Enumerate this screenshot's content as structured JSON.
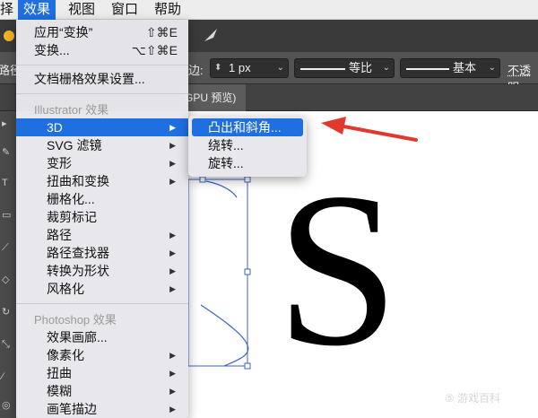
{
  "menubar": {
    "items": [
      {
        "label": "择"
      },
      {
        "label": "效果",
        "active": true
      },
      {
        "label": "视图"
      },
      {
        "label": "窗口"
      },
      {
        "label": "帮助"
      }
    ]
  },
  "controlbar": {
    "path_label": "路径",
    "edge_label": "边:",
    "stroke_weight": "1 px",
    "profile_label": "等比",
    "brush_label": "基本",
    "opacity_label": "不透明"
  },
  "tabbar": {
    "doc_tab": "GPU 预览)"
  },
  "effect_menu": {
    "apply_last": {
      "label": "应用“变换”",
      "shortcut": "⇧⌘E"
    },
    "last_effect": {
      "label": "变换...",
      "shortcut": "⌥⇧⌘E"
    },
    "raster_settings": "文档栅格效果设置...",
    "illustrator_header": "Illustrator 效果",
    "illustrator_items": [
      "3D",
      "SVG 滤镜",
      "变形",
      "扭曲和变换",
      "栅格化...",
      "裁剪标记",
      "路径",
      "路径查找器",
      "转换为形状",
      "风格化"
    ],
    "photoshop_header": "Photoshop 效果",
    "photoshop_items": [
      "效果画廊...",
      "像素化",
      "扭曲",
      "模糊",
      "画笔描边"
    ]
  },
  "submenu_3d": {
    "items": [
      "凸出和斜角...",
      "绕转...",
      "旋转..."
    ]
  },
  "canvas": {
    "letter": "S",
    "watermark": "⑤ 游戏百科"
  },
  "colors": {
    "accent": "#1f6fe0",
    "arrow": "#e2392f",
    "path": "#3f63c8"
  }
}
